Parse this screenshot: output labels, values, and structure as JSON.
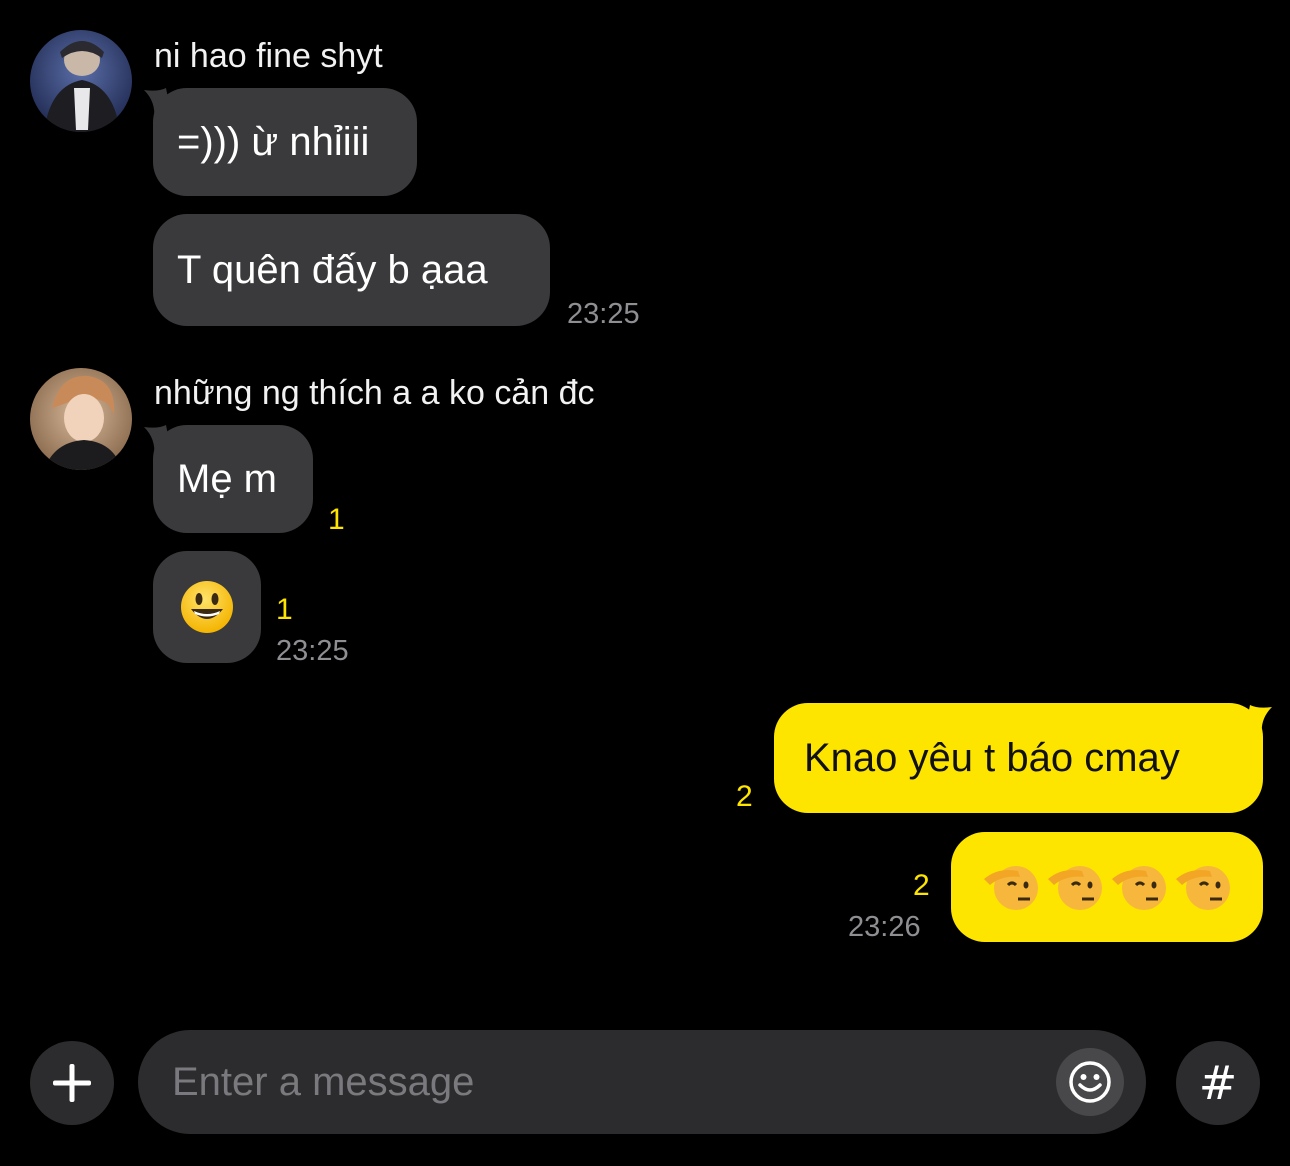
{
  "colors": {
    "background": "#000000",
    "incoming_bubble": "#3a3a3c",
    "outgoing_bubble": "#fee500",
    "unread_count": "#fee500",
    "timestamp": "#8e8e93"
  },
  "conversation": {
    "group1": {
      "sender": "ni hao fine shyt",
      "avatar_icon": "profile-photo-icon",
      "messages": [
        {
          "text": "=))) ừ nhỉiii"
        },
        {
          "text": "T quên đấy b ạaa"
        }
      ],
      "time": "23:25"
    },
    "group2": {
      "sender": "những ng thích a a ko cản đc",
      "avatar_icon": "profile-photo-icon",
      "messages": [
        {
          "text": "Mẹ m",
          "unread": "1"
        },
        {
          "emoji": "smiley-face-icon",
          "unread": "1"
        }
      ],
      "time": "23:25"
    },
    "group3": {
      "messages": [
        {
          "text": "Knao yêu t báo cmay",
          "unread": "2"
        },
        {
          "emoji": "saluting-face-icon",
          "count": 4,
          "unread": "2"
        }
      ],
      "time": "23:26"
    }
  },
  "composer": {
    "plus_icon": "plus-icon",
    "placeholder": "Enter a message",
    "value": "",
    "emoji_icon": "emoji-icon",
    "hash_label": "#",
    "hash_icon": "hash-icon"
  }
}
